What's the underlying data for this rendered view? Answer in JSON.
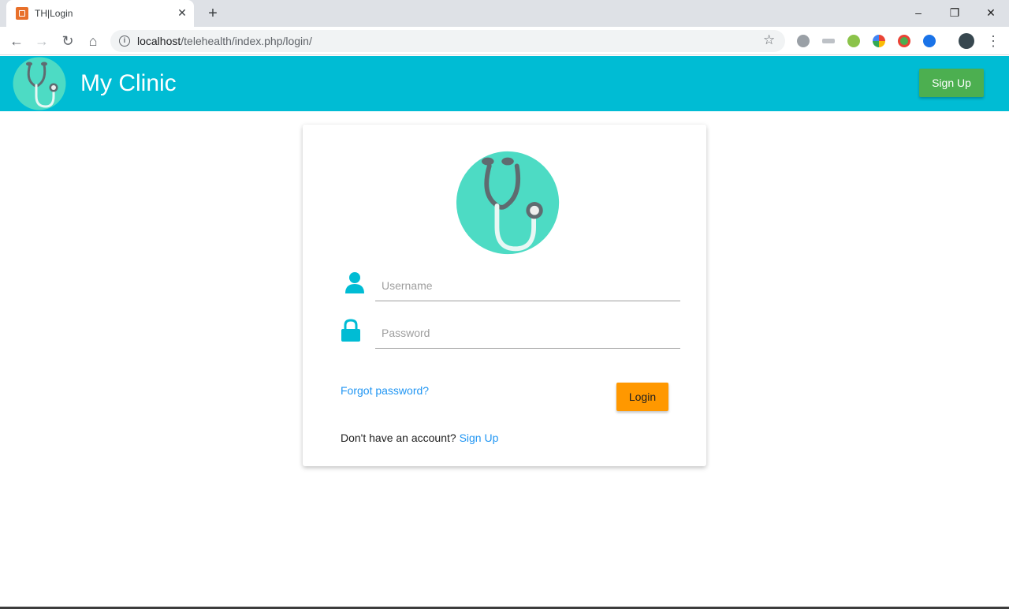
{
  "browser": {
    "tab_title": "TH|Login",
    "tab_close": "✕",
    "new_tab": "+",
    "url_host": "localhost",
    "url_path": "/telehealth/index.php/login/",
    "window_controls": {
      "minimize": "–",
      "restore": "❐",
      "close": "✕"
    },
    "nav": {
      "back": "←",
      "forward": "→",
      "reload": "↻",
      "home": "⌂"
    },
    "star": "☆",
    "menu": "⋮",
    "extensions": [
      {
        "name": "ext-gear-icon",
        "color": "#9aa0a6"
      },
      {
        "name": "ext-scissors-icon",
        "color": "#9aa0a6"
      },
      {
        "name": "ext-shield-icon",
        "color": "#8bc34a"
      },
      {
        "name": "ext-colorful-icon",
        "color": "#ea4335"
      },
      {
        "name": "ext-grammarly-icon",
        "color": "#4caf50"
      },
      {
        "name": "ext-share-icon",
        "color": "#1a73e8"
      }
    ]
  },
  "header": {
    "title": "My Clinic",
    "signup_label": "Sign Up",
    "color": "#00bcd4"
  },
  "login": {
    "username_placeholder": "Username",
    "password_placeholder": "Password",
    "forgot_label": "Forgot password?",
    "login_label": "Login",
    "no_account_text": "Don't have an account?",
    "signup_link": "Sign Up"
  },
  "colors": {
    "accent": "#00bcd4",
    "signup_button": "#4caf50",
    "login_button": "#ff9800",
    "link": "#2196f3",
    "logo_circle": "#4ddbc4"
  }
}
